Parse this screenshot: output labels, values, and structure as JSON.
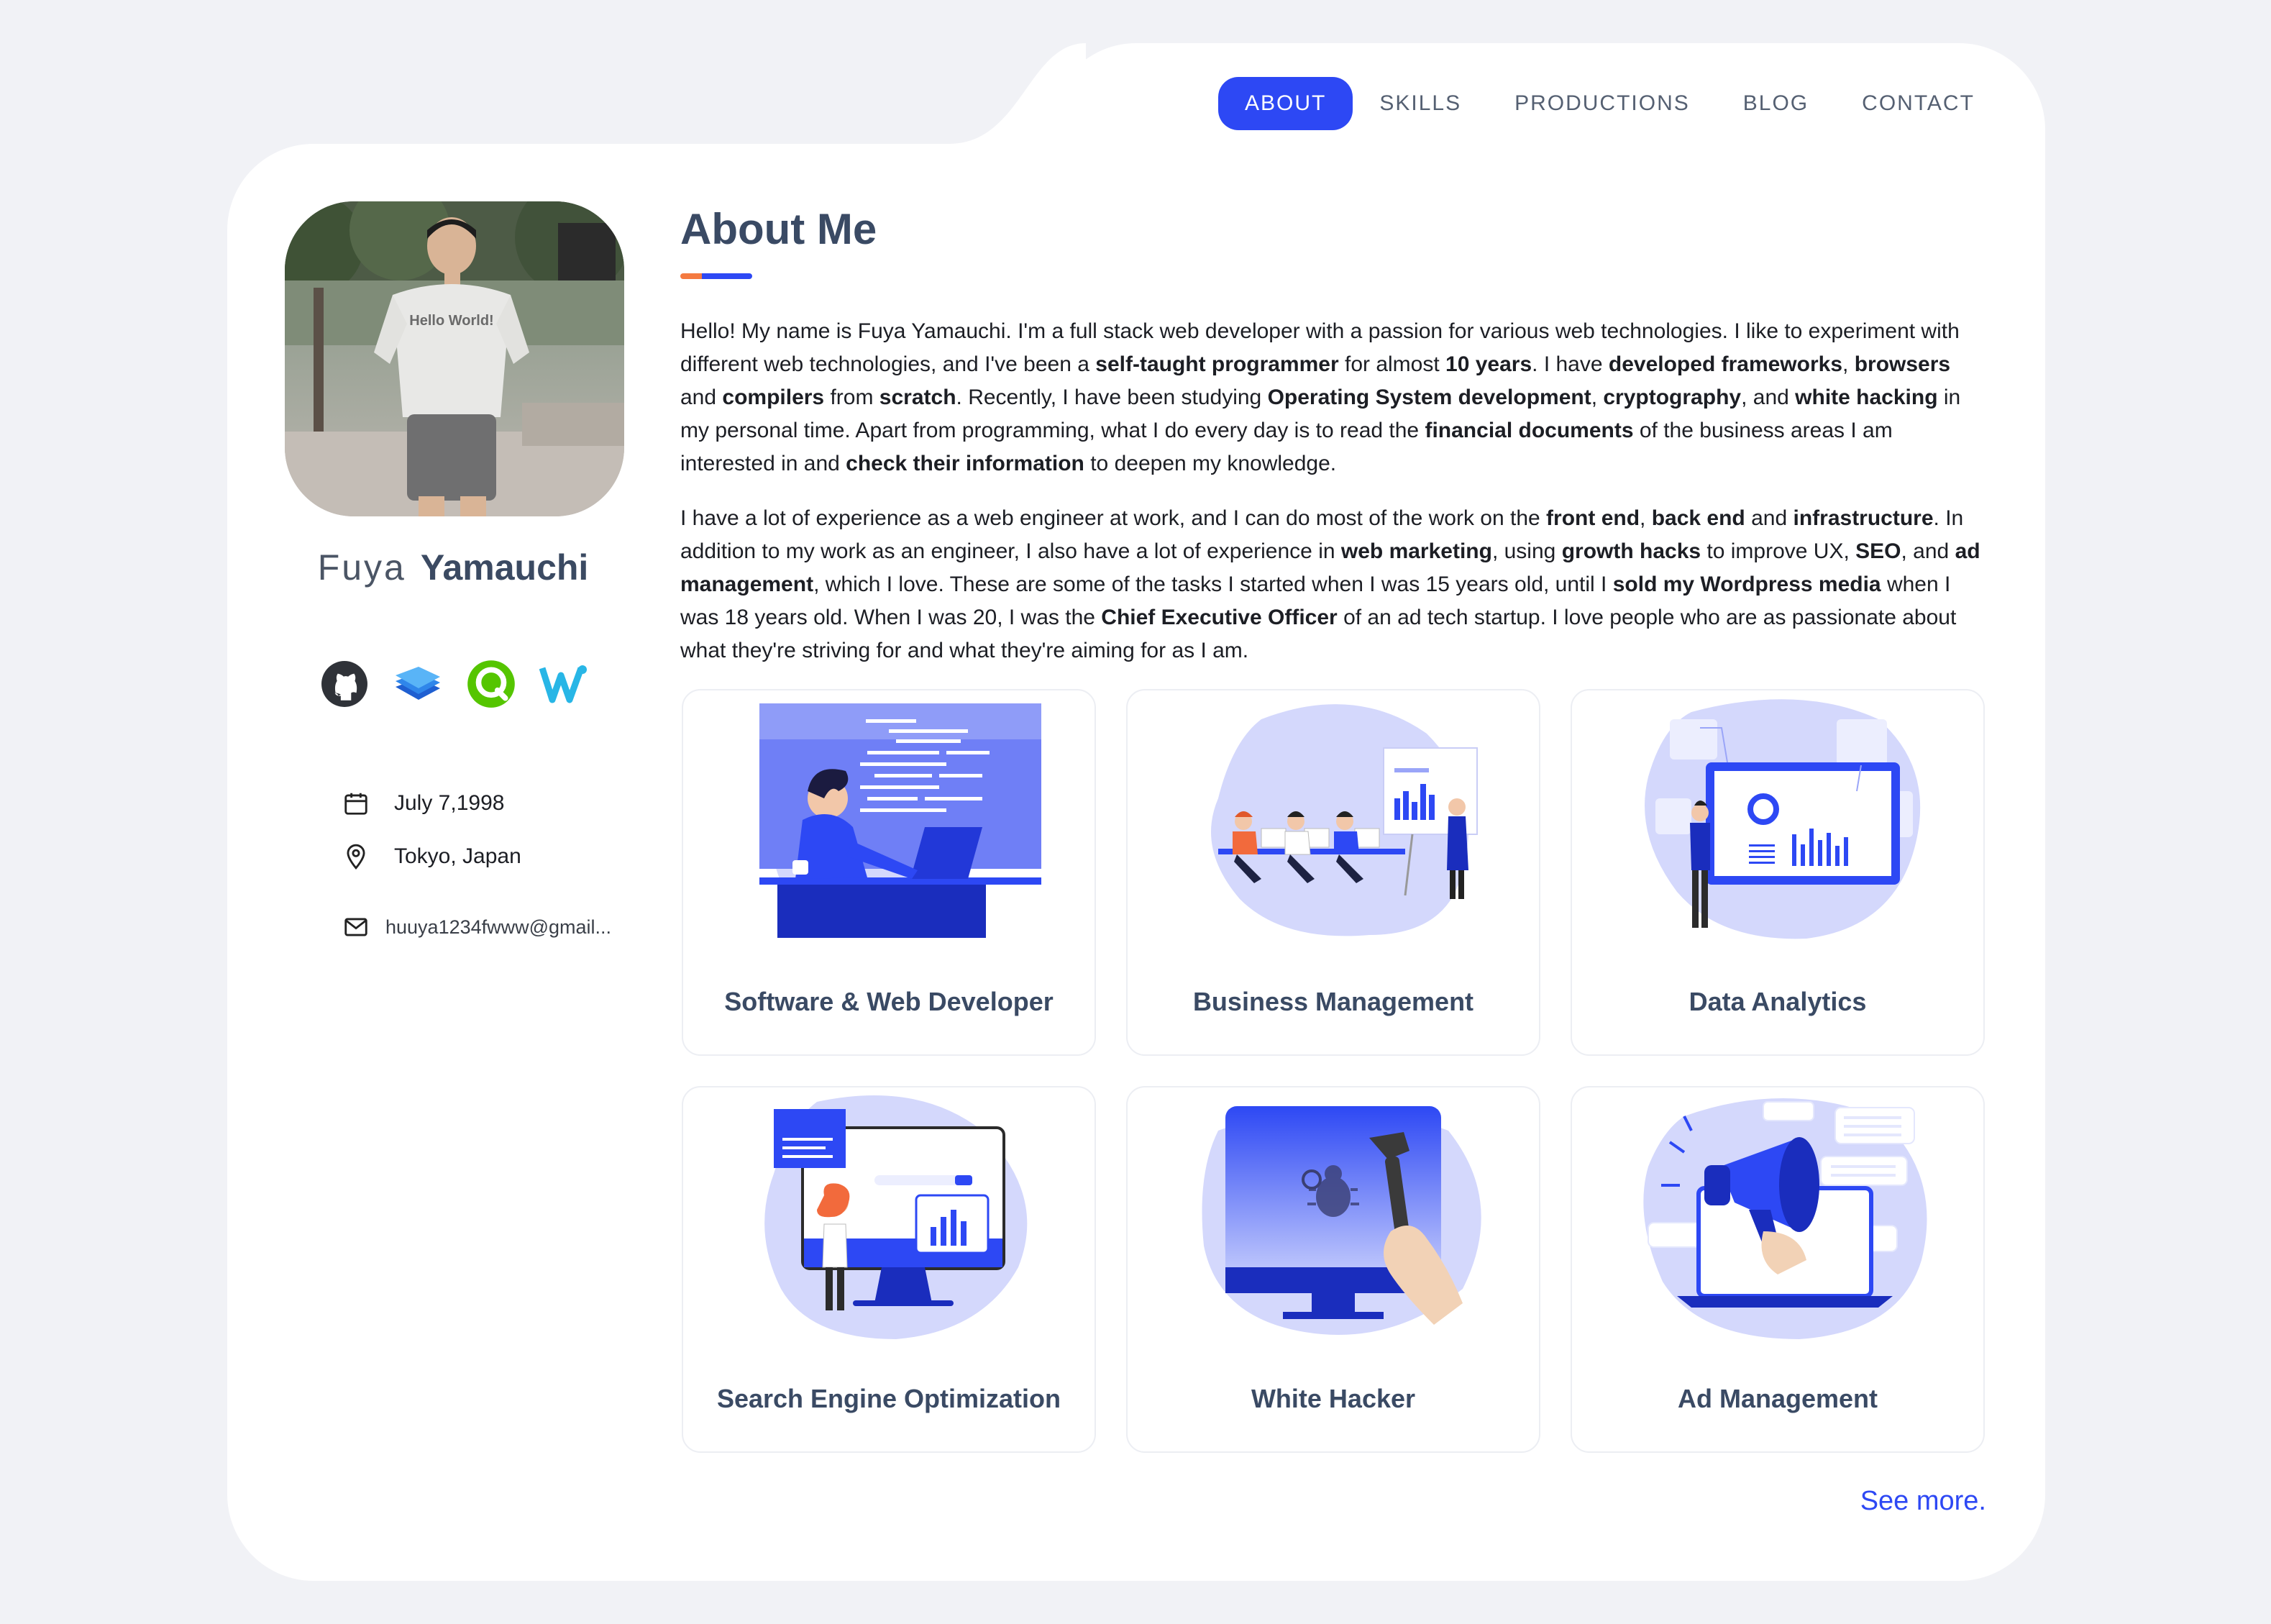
{
  "nav": {
    "items": [
      {
        "label": "ABOUT",
        "active": true
      },
      {
        "label": "SKILLS",
        "active": false
      },
      {
        "label": "PRODUCTIONS",
        "active": false
      },
      {
        "label": "BLOG",
        "active": false
      },
      {
        "label": "CONTACT",
        "active": false
      }
    ]
  },
  "profile": {
    "first_name": "Fuya",
    "last_name": "Yamauchi",
    "photo_alt": "Profile photo",
    "shirt_text": "Hello World!",
    "socials": [
      {
        "icon": "github-icon"
      },
      {
        "icon": "stack-icon"
      },
      {
        "icon": "qiita-icon"
      },
      {
        "icon": "wantedly-icon"
      }
    ],
    "birthday": "July 7,1998",
    "location": "Tokyo, Japan",
    "email": "huuya1234fwww@gmail..."
  },
  "about": {
    "title": "About Me",
    "p1": [
      {
        "t": "Hello! My name is Fuya Yamauchi. I'm a full stack web developer with a passion for various web technologies. I like to experiment with different web technologies, and I've been a ",
        "b": false
      },
      {
        "t": "self-taught programmer",
        "b": true
      },
      {
        "t": " for almost ",
        "b": false
      },
      {
        "t": "10 years",
        "b": true
      },
      {
        "t": ". I have ",
        "b": false
      },
      {
        "t": "developed frameworks",
        "b": true
      },
      {
        "t": ", ",
        "b": false
      },
      {
        "t": "browsers",
        "b": true
      },
      {
        "t": " and ",
        "b": false
      },
      {
        "t": "compilers",
        "b": true
      },
      {
        "t": " from ",
        "b": false
      },
      {
        "t": "scratch",
        "b": true
      },
      {
        "t": ". Recently, I have been studying ",
        "b": false
      },
      {
        "t": "Operating System development",
        "b": true
      },
      {
        "t": ", ",
        "b": false
      },
      {
        "t": "cryptography",
        "b": true
      },
      {
        "t": ", and ",
        "b": false
      },
      {
        "t": "white hacking",
        "b": true
      },
      {
        "t": " in my personal time. Apart from programming, what I do every day is to read the ",
        "b": false
      },
      {
        "t": "financial documents",
        "b": true
      },
      {
        "t": " of the business areas I am interested in and ",
        "b": false
      },
      {
        "t": "check their information",
        "b": true
      },
      {
        "t": " to deepen my knowledge.",
        "b": false
      }
    ],
    "p2": [
      {
        "t": "I have a lot of experience as a web engineer at work, and I can do most of the work on the ",
        "b": false
      },
      {
        "t": "front end",
        "b": true
      },
      {
        "t": ", ",
        "b": false
      },
      {
        "t": "back end",
        "b": true
      },
      {
        "t": " and ",
        "b": false
      },
      {
        "t": "infrastructure",
        "b": true
      },
      {
        "t": ". In addition to my work as an engineer, I also have a lot of experience in ",
        "b": false
      },
      {
        "t": "web marketing",
        "b": true
      },
      {
        "t": ", using ",
        "b": false
      },
      {
        "t": "growth hacks",
        "b": true
      },
      {
        "t": " to improve UX, ",
        "b": false
      },
      {
        "t": "SEO",
        "b": true
      },
      {
        "t": ", and ",
        "b": false
      },
      {
        "t": "ad management",
        "b": true
      },
      {
        "t": ", which I love. These are some of the tasks I started when I was 15 years old, until I ",
        "b": false
      },
      {
        "t": "sold my Wordpress media",
        "b": true
      },
      {
        "t": " when I was 18 years old. When I was 20, I was the ",
        "b": false
      },
      {
        "t": "Chief Executive Officer",
        "b": true
      },
      {
        "t": " of an ad tech startup. I love people who are as passionate about what they're striving for and what they're aiming for as I am.",
        "b": false
      }
    ]
  },
  "skills": [
    {
      "label": "Software & Web Developer",
      "icon": "developer-illustration"
    },
    {
      "label": "Business Management",
      "icon": "business-illustration"
    },
    {
      "label": "Data Analytics",
      "icon": "analytics-illustration"
    },
    {
      "label": "Search Engine Optimization",
      "icon": "seo-illustration"
    },
    {
      "label": "White Hacker",
      "icon": "hacker-illustration"
    },
    {
      "label": "Ad Management",
      "icon": "megaphone-illustration"
    }
  ],
  "see_more": "See more.",
  "colors": {
    "accent": "#2d48f4",
    "accent_orange": "#f47a40",
    "heading": "#3a4a64"
  }
}
